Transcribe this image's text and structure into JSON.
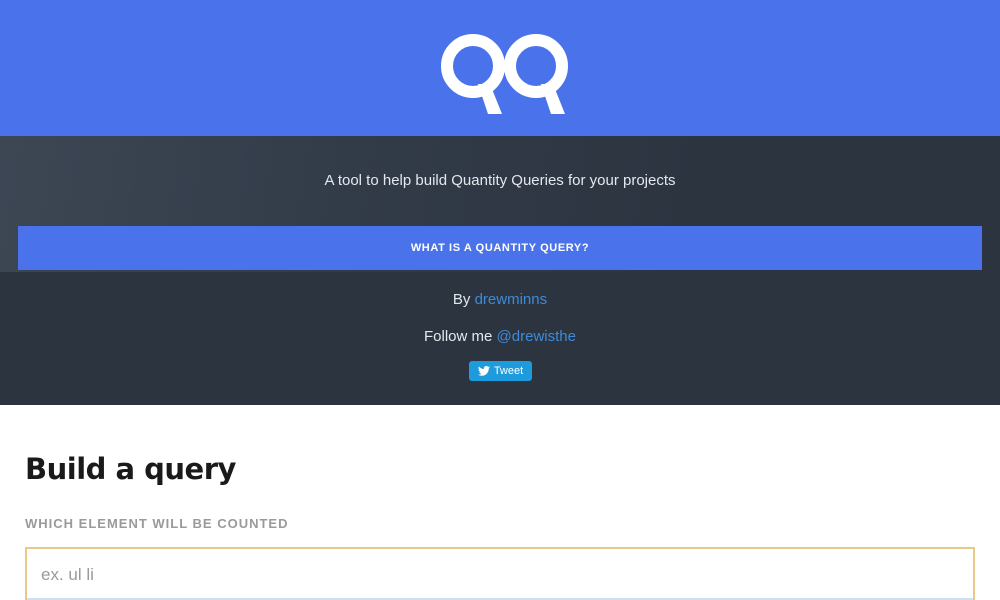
{
  "header": {
    "logo_icon": "qq-logo-icon",
    "brand_color": "#4a72ea"
  },
  "hero": {
    "tagline": "A tool to help build Quantity Queries for your projects",
    "what_button_label": "WHAT IS A QUANTITY QUERY?",
    "by_prefix": "By",
    "by_link": "drewminns",
    "follow_prefix": "Follow me",
    "follow_link": "@drewisthe",
    "tweet_label": "Tweet",
    "tweet_icon": "twitter-bird-icon",
    "link_color": "#3d8bd8"
  },
  "builder": {
    "title": "Build a query",
    "element_label": "WHICH ELEMENT WILL BE COUNTED",
    "element_value": "",
    "element_placeholder": "ex. ul li"
  }
}
